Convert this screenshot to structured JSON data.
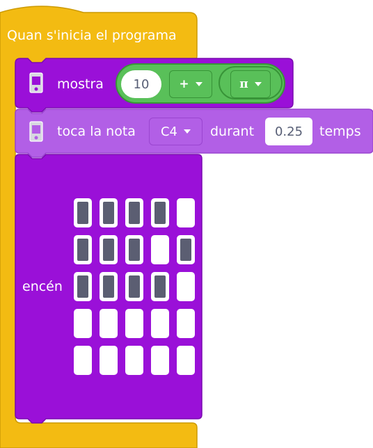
{
  "colors": {
    "event": "#f3bb12",
    "event_border": "#cc9a04",
    "microbit": "#9a10d8",
    "microbit_border": "#7a0bb0",
    "music": "#b25fe6",
    "operator": "#59c059",
    "operator_border": "#389438",
    "led_on": "#5b5e72",
    "led_off": "#ffffff"
  },
  "hat_block": {
    "label": "Quan s'inicia el programa"
  },
  "show_block": {
    "label": "mostra",
    "icon": "microbit-icon",
    "operator": {
      "left_value": "10",
      "op": "+",
      "right_value": "π"
    }
  },
  "note_block": {
    "label": "toca la nota",
    "icon": "microbit-icon",
    "note": "C4",
    "during_label": "durant",
    "beats": "0.25",
    "unit_label": "temps"
  },
  "leds_block": {
    "label": "encén",
    "matrix": [
      [
        1,
        1,
        1,
        1,
        0
      ],
      [
        1,
        1,
        1,
        0,
        1
      ],
      [
        1,
        1,
        1,
        1,
        0
      ],
      [
        0,
        0,
        0,
        0,
        0
      ],
      [
        0,
        0,
        0,
        0,
        0
      ]
    ]
  }
}
